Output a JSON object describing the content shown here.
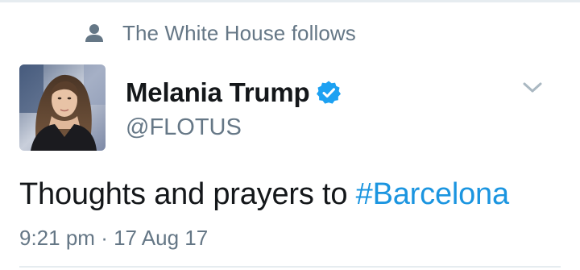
{
  "social_context": {
    "icon": "person-icon",
    "text": "The White House follows"
  },
  "tweet": {
    "avatar_icon": "profile-photo",
    "display_name": "Melania Trump",
    "verified": true,
    "handle": "@FLOTUS",
    "caret_icon": "chevron-down-icon",
    "text_prefix": "Thoughts and prayers to ",
    "hashtag": "#Barcelona",
    "time": "9:21 pm",
    "separator": "·",
    "date": "17 Aug 17"
  },
  "colors": {
    "text_primary": "#14171a",
    "text_secondary": "#657786",
    "link": "#1b95e0",
    "verified_badge": "#1da1f2"
  }
}
